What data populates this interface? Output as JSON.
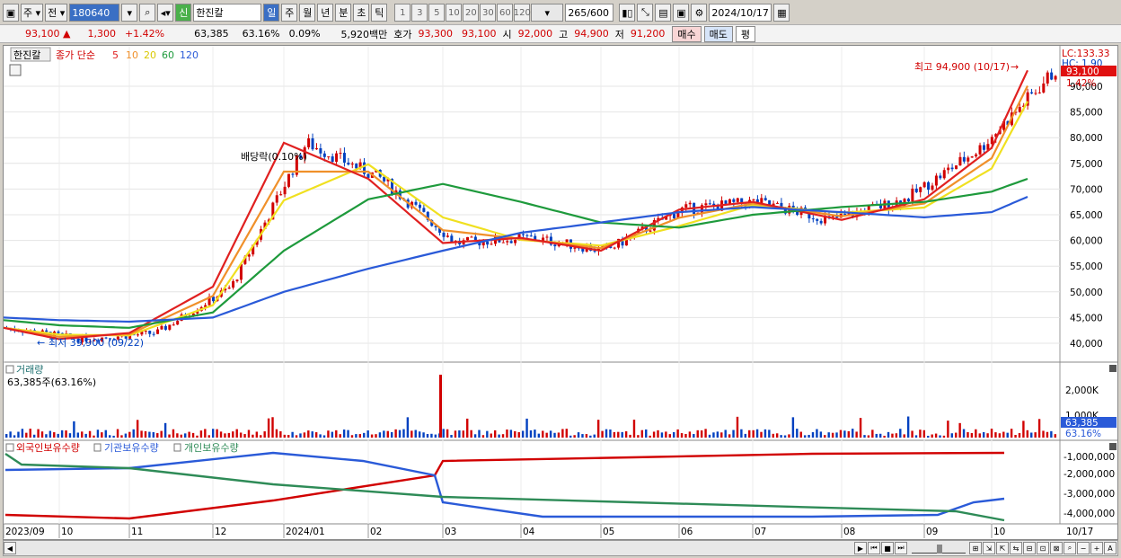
{
  "toolbar": {
    "period_type": "주",
    "market": "전",
    "stock_code": "180640",
    "badge_new": "신",
    "stock_name": "한진칼",
    "intervals": [
      "일",
      "주",
      "월",
      "년",
      "분",
      "초",
      "틱"
    ],
    "selected_interval": "일",
    "numbers": [
      "1",
      "3",
      "5",
      "10",
      "20",
      "30",
      "60",
      "120"
    ],
    "count_current": "265",
    "count_max": "/600",
    "date": "2024/10/17"
  },
  "quote": {
    "price": "93,100",
    "arrow": "▲",
    "change": "1,300",
    "change_pct": "+1.42%",
    "volume": "63,385",
    "volume_ratio": "63.16%",
    "turnover": "0.09%",
    "amount": "5,920백만",
    "ask_label": "호가",
    "ask": "93,300",
    "bid": "93,100",
    "open_label": "시",
    "open": "92,000",
    "high_label": "고",
    "high": "94,900",
    "low_label": "저",
    "low": "91,200",
    "buy_btn": "매수",
    "sell_btn": "매도",
    "eval_btn": "평"
  },
  "price_panel": {
    "legend_name": "한진칼",
    "legend_ma_label": "종가 단순",
    "ma_periods": [
      "5",
      "10",
      "20",
      "60",
      "120"
    ],
    "ma_colors": [
      "#e02020",
      "#f0902a",
      "#f0e020",
      "#1e9a3c",
      "#2a5ad8"
    ],
    "high_annotation": "최고 94,900 (10/17)",
    "low_annotation": "최저 39,900 (09/22)",
    "dividend_annotation": "배당락(0.10%)",
    "lc": "LC:133.33",
    "hc": "HC: 1.90",
    "current_tag": "93,100",
    "current_pct": "1.42%",
    "y_ticks": [
      "90,000",
      "85,000",
      "80,000",
      "75,000",
      "70,000",
      "65,000",
      "60,000",
      "55,000",
      "50,000",
      "45,000",
      "40,000"
    ],
    "up_color": "#d10000",
    "down_color": "#0040c0"
  },
  "volume_panel": {
    "title": "거래량",
    "value_text": "63,385주(63.16%)",
    "y_ticks": [
      "2,000K",
      "1,000K"
    ],
    "current_tag": "63,385",
    "current_pct": "63.16%"
  },
  "holdings_panel": {
    "legend": [
      "외국인보유수량",
      "기관보유수량",
      "개인보유수량"
    ],
    "colors": [
      "#d10000",
      "#2a5ad8",
      "#2e8b57"
    ],
    "y_ticks": [
      "-1,000,000",
      "-2,000,000",
      "-3,000,000",
      "-4,000,000"
    ]
  },
  "x_axis": {
    "labels": [
      "2023/09",
      "10",
      "11",
      "12",
      "2024/01",
      "02",
      "03",
      "04",
      "05",
      "06",
      "07",
      "08",
      "09",
      "10"
    ],
    "end_label": "10/17"
  },
  "chart_data": {
    "type": "line",
    "title": "",
    "xlabel": "",
    "ylabel": "",
    "ylim": [
      37500,
      96000
    ],
    "x": [
      "2023/09",
      "10",
      "11",
      "12",
      "2024/01",
      "02",
      "03",
      "04",
      "05",
      "06",
      "07",
      "08",
      "09",
      "10",
      "10/17"
    ],
    "series": [
      {
        "name": "종가",
        "values": [
          43000,
          40800,
          42000,
          51000,
          79000,
          72000,
          59500,
          60500,
          58000,
          66000,
          67500,
          64000,
          68000,
          78000,
          93100
        ]
      },
      {
        "name": "120",
        "values": [
          45000,
          44500,
          44200,
          45000,
          50000,
          54500,
          58000,
          61500,
          63500,
          65500,
          66500,
          65500,
          64500,
          65500,
          68500
        ]
      },
      {
        "name": "60",
        "values": [
          44500,
          43500,
          43000,
          46000,
          58000,
          68000,
          71000,
          67500,
          63500,
          62500,
          65000,
          66500,
          67500,
          69500,
          72000
        ]
      }
    ],
    "volume_max": 2500000,
    "volume_last": 63385
  }
}
